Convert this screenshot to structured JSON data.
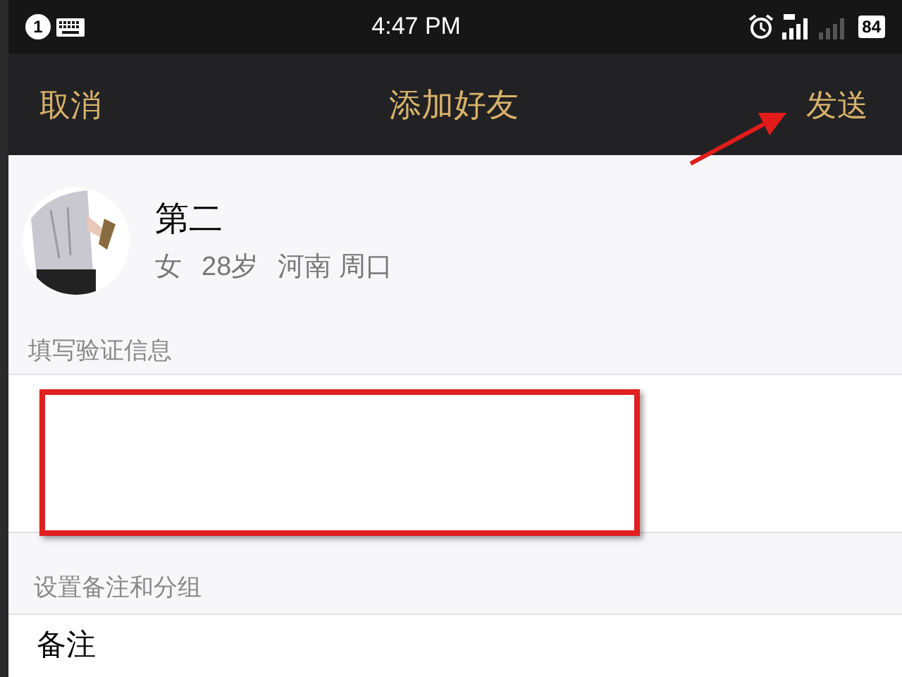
{
  "status_bar": {
    "notification_count": "1",
    "time": "4:47 PM",
    "battery": "84"
  },
  "nav_bar": {
    "cancel": "取消",
    "title": "添加好友",
    "send": "发送"
  },
  "profile": {
    "name": "第二",
    "details": [
      "女",
      "28岁",
      "河南 周口"
    ]
  },
  "verify_section": {
    "label": "填写验证信息"
  },
  "remark_section": {
    "label": "设置备注和分组",
    "rows": [
      {
        "label": "备注"
      }
    ]
  }
}
